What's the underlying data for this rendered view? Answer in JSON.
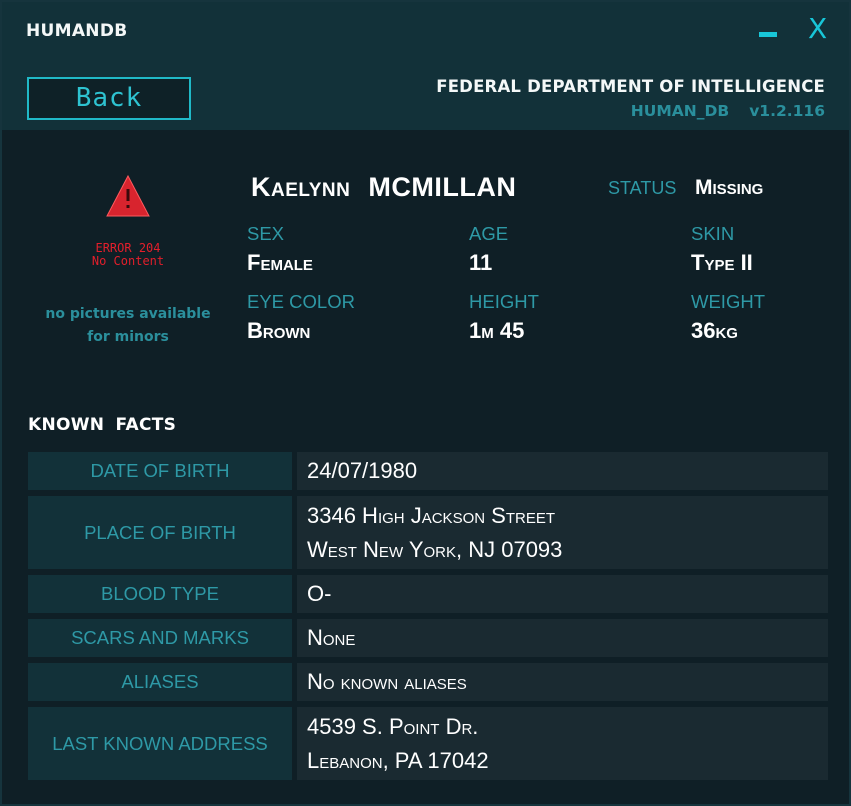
{
  "window": {
    "title": "HUMANDB",
    "minimize_glyph": "minimize-icon",
    "close_glyph": "X"
  },
  "header": {
    "back_label": "Back",
    "agency": "FEDERAL DEPARTMENT OF INTELLIGENCE",
    "db_name": "HUMAN_DB",
    "version": "v1.2.116"
  },
  "photo": {
    "icon": "warning-triangle-icon",
    "error_line1": "ERROR 204",
    "error_line2": "No Content",
    "note": "no pictures available for minors"
  },
  "person": {
    "name": "Kaelynn MCMILLAN",
    "status_label": "STATUS",
    "status_value": "Missing",
    "attributes": [
      {
        "label": "SEX",
        "value": "Female"
      },
      {
        "label": "AGE",
        "value": "11"
      },
      {
        "label": "SKIN",
        "value": "Type II"
      },
      {
        "label": "EYE COLOR",
        "value": "Brown"
      },
      {
        "label": "HEIGHT",
        "value": "1m 45"
      },
      {
        "label": "WEIGHT",
        "value": "36kg"
      }
    ]
  },
  "facts": {
    "title": "KNOWN FACTS",
    "rows": [
      {
        "label": "DATE OF BIRTH",
        "value": [
          "24/07/1980"
        ]
      },
      {
        "label": "PLACE OF BIRTH",
        "value": [
          "3346 High Jackson Street",
          "West New York, NJ 07093"
        ]
      },
      {
        "label": "BLOOD TYPE",
        "value": [
          "O-"
        ]
      },
      {
        "label": "SCARS AND MARKS",
        "value": [
          "None"
        ]
      },
      {
        "label": "ALIASES",
        "value": [
          "No known aliases"
        ]
      },
      {
        "label": "LAST KNOWN ADDRESS",
        "value": [
          "4539 S. Point Dr.",
          "Lebanon, PA 17042"
        ]
      }
    ]
  },
  "colors": {
    "accent": "#18c6d8",
    "label": "#2e99a6",
    "error": "#e21f2b",
    "panel": "#123139",
    "value_cell": "#1a2a31"
  }
}
